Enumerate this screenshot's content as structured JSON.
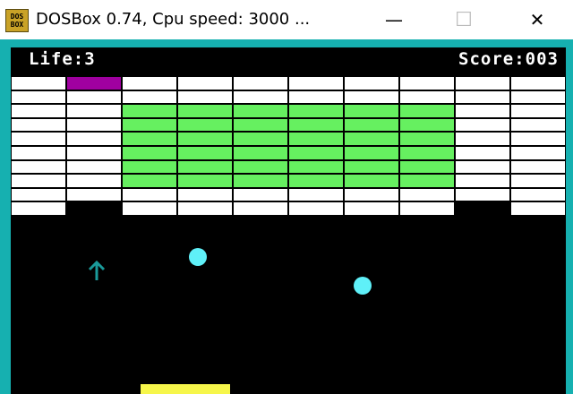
{
  "window": {
    "icon_text": [
      "DOS",
      "BOX"
    ],
    "title": "DOSBox 0.74, Cpu speed:     3000 ...",
    "minimize_glyph": "—",
    "maximize_glyph": "☐",
    "close_glyph": "✕"
  },
  "hud": {
    "life": "Life:3",
    "score": "Score:003"
  },
  "bricks": {
    "columns": 10,
    "rows": 10,
    "colors": {
      "W": "#ffffff",
      "G": "#66f060",
      "M": "#a000a0",
      "E": null
    },
    "grid": [
      "WMWWWWWWWW",
      "WWWWWWWWWW",
      "WWGGGGGGWW",
      "WWGGGGGGWW",
      "WWGGGGGGWW",
      "WWGGGGGGWW",
      "WWGGGGGGWW",
      "WWGGGGGGWW",
      "WWWWWWWWWW",
      "WEWWWWWWEW"
    ]
  },
  "balls_count": 2,
  "powerup_icon": "arrow-up-icon",
  "colors": {
    "frame": "#16b0b0",
    "background": "#000000",
    "ball": "#5ff0f8",
    "paddle": "#f6f64a",
    "powerup": "#1a9a9a"
  }
}
